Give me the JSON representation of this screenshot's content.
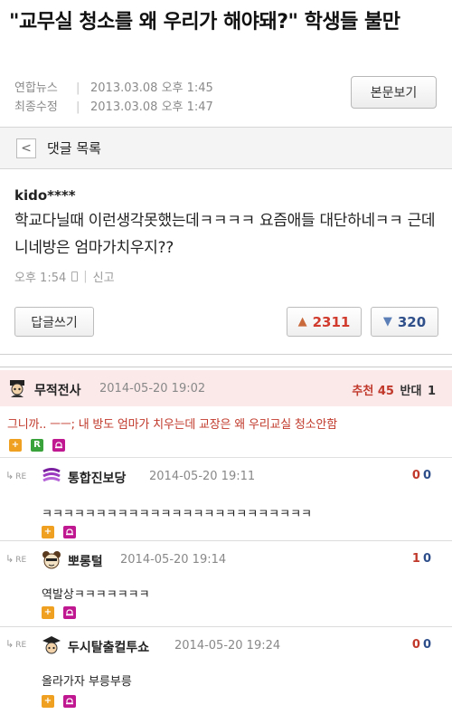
{
  "article": {
    "title": "\"교무실 청소를 왜 우리가 해야돼?\" 학생들 불만",
    "source_label": "연합뉴스",
    "published": "2013.03.08 오후 1:45",
    "modified_label": "최종수정",
    "modified": "2013.03.08 오후 1:47",
    "separator": "|",
    "view_original_label": "본문보기"
  },
  "comments_bar": {
    "back_glyph": "<",
    "title": "댓글 목록"
  },
  "comment": {
    "user": "kido****",
    "text": "학교다닐때 이런생각못했는데ㅋㅋㅋㅋ 요즘애들 대단하네ㅋㅋ 근데 니네방은 엄마가치우지??",
    "time": "오후 1:54",
    "report_label": "신고",
    "reply_button": "답글쓰기",
    "likes": "2311",
    "dislikes": "320"
  },
  "board": {
    "best": {
      "nick": "무적전사",
      "time": "2014-05-20 19:02",
      "rec_label": "추천",
      "rec_value": "45",
      "opp_label": "반대",
      "opp_value": "1",
      "text": "그니까.. ㅡㅡ; 내 방도 엄마가 치우는데 교장은 왜 우리교실 청소안함",
      "icon_r": "R",
      "icon_plus": "+"
    },
    "re_label": "RE",
    "replies": [
      {
        "nick": "통합진보당",
        "time": "2014-05-20 19:11",
        "up": "0",
        "down": "0",
        "text": "ㅋㅋㅋㅋㅋㅋㅋㅋㅋㅋㅋㅋㅋㅋㅋㅋㅋㅋㅋㅋㅋㅋㅋㅋㅋ"
      },
      {
        "nick": "뽀롱털",
        "time": "2014-05-20 19:14",
        "up": "1",
        "down": "0",
        "text": "역발상ㅋㅋㅋㅋㅋㅋㅋ"
      },
      {
        "nick": "두시탈출컬투쇼",
        "time": "2014-05-20 19:24",
        "up": "0",
        "down": "0",
        "text": "올라가자 부릉부릉"
      }
    ]
  },
  "colors": {
    "like": "#d03b2e",
    "dislike": "#2f4f8a",
    "best_bg": "#fbe9ea",
    "best_text": "#c0392b"
  }
}
